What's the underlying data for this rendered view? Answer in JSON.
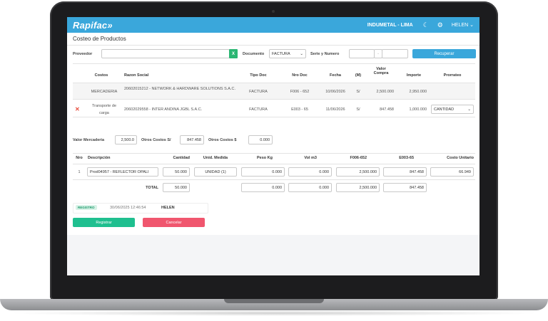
{
  "app": {
    "brand": "Rapifac",
    "company": "INDUMETAL - LIMA",
    "user": "HELEN ⌄"
  },
  "page": {
    "title": "Costeo de Productos"
  },
  "filters": {
    "proveedor_label": "Proveedor",
    "proveedor_value": "",
    "clear_label": "X",
    "documento_label": "Documento",
    "documento_value": "FACTURA",
    "serie_label": "Serie y Numero",
    "serie_value": "",
    "serie_sep": "-",
    "numero_value": "",
    "recuperar_label": "Recuperar"
  },
  "costs_table": {
    "headers": {
      "costos": "Costos",
      "razon": "Razon Social",
      "tipo": "Tipo Doc",
      "nro": "Nro Doc",
      "fecha": "Fecha",
      "m": "(M)",
      "valor": "Valor\nCompra",
      "importe": "Importe",
      "prorrateo": "Prorrateo"
    },
    "rows": [
      {
        "costos": "MERCADERIA",
        "razon": "20602015212 - NETWORK & HARDWARE SOLUTIONS S.A.C.",
        "tipo": "FACTURA",
        "nro": "F006 - 652",
        "fecha": "10/06/2026",
        "m": "S/",
        "valor": "2,500.000",
        "importe": "2,950.000",
        "prorrateo": ""
      },
      {
        "costos": "Transporte de carga",
        "razon": "20602029558 - INTER ANDINA JGBL S.A.C.",
        "tipo": "FACTURA",
        "nro": "E003 - 65",
        "fecha": "11/06/2026",
        "m": "S/",
        "valor": "847.458",
        "importe": "1,000.000",
        "prorrateo": "CANTIDAD"
      }
    ]
  },
  "summary": {
    "valor_merc_label": "Valor Mercaderia",
    "valor_merc": "2,500.0",
    "otros_s_label": "Otros Costos S/",
    "otros_s": "847.458",
    "otros_usd_label": "Otros Costos $",
    "otros_usd": "0.000"
  },
  "product_table": {
    "headers": {
      "nro": "Nro",
      "desc": "Descripción",
      "cant": "Cantidad",
      "unid": "Unid. Medida",
      "peso": "Peso Kg",
      "vol": "Vol m3",
      "f006": "F006-652",
      "e003": "E003-65",
      "costo": "Costo Unitario"
    },
    "rows": [
      {
        "nro": "1",
        "desc": "Prod04957 - REFLECTOR OPALI",
        "cant": "50.000",
        "unid": "UNIDAD (1)",
        "peso": "0.000",
        "vol": "0.000",
        "f006": "2,500.000",
        "e003": "847.458",
        "costo": "66.949"
      }
    ],
    "total": {
      "label": "TOTAL",
      "cant": "50.000",
      "peso": "0.000",
      "vol": "0.000",
      "f006": "2,500.000",
      "e003": "847.458"
    }
  },
  "registro": {
    "badge": "REGISTRO",
    "datetime": "30/06/2025 12:46:54",
    "user": "HELEN"
  },
  "actions": {
    "registrar": "Registrar",
    "cancelar": "Cancelar"
  },
  "colors": {
    "accent": "#3aa7db",
    "success": "#1fbf8f",
    "danger": "#f0566e"
  },
  "icons": {
    "theme": "moon-icon",
    "settings": "gear-icon",
    "delete": "close-icon"
  }
}
